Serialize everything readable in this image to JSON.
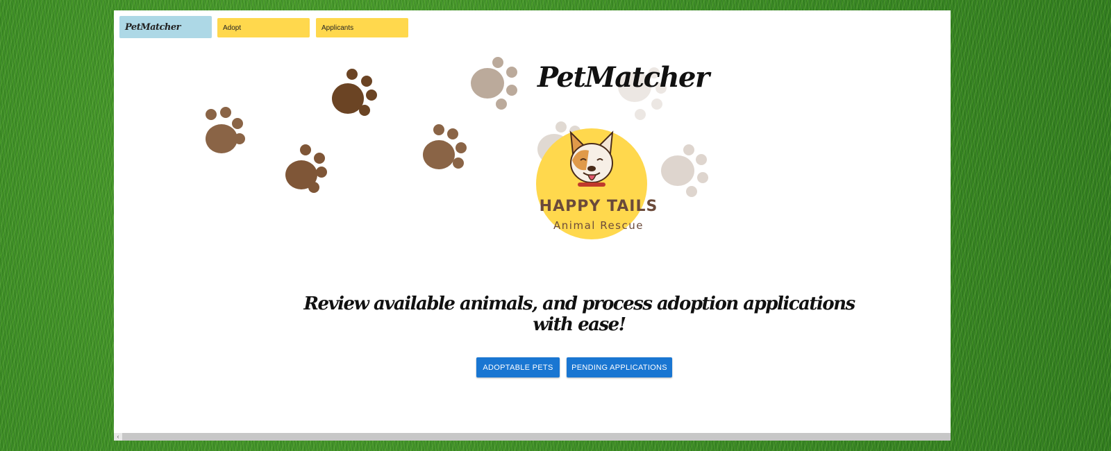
{
  "navbar": {
    "brand": "PetMatcher",
    "adopt_label": "Adopt",
    "applicants_label": "Applicants"
  },
  "hero": {
    "title": "PetMatcher",
    "logo": {
      "name": "HAPPY TAILS",
      "subtitle": "Animal Rescue"
    },
    "tagline": "Review available animals, and process adoption applications with ease!"
  },
  "actions": {
    "adoptable_pets_label": "ADOPTABLE PETS",
    "pending_applications_label": "PENDING APPLICATIONS"
  },
  "colors": {
    "brand_button": "#add8e6",
    "nav_button": "#ffd84d",
    "primary_button": "#1976d2",
    "paw_dark": "#6b4424",
    "paw_medium": "#8a6446"
  },
  "icons": [
    "paw-print-icon",
    "dog-face-icon",
    "scroll-left-arrow-icon"
  ]
}
